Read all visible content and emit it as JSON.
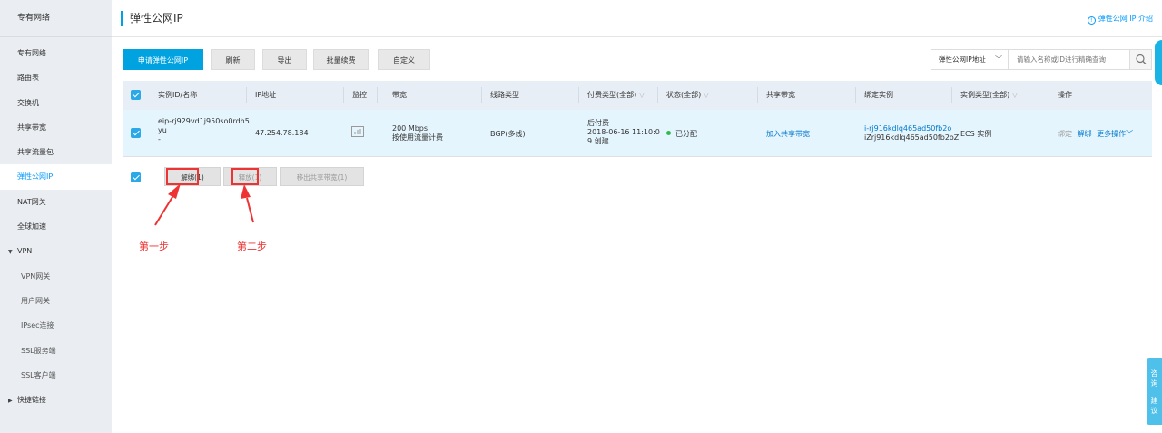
{
  "sidebar": {
    "title": "专有网络",
    "items": [
      {
        "label": "专有网络"
      },
      {
        "label": "路由表"
      },
      {
        "label": "交换机"
      },
      {
        "label": "共享带宽"
      },
      {
        "label": "共享流量包"
      },
      {
        "label": "弹性公网IP"
      },
      {
        "label": "NAT网关"
      },
      {
        "label": "全球加速"
      }
    ],
    "vpn_group": {
      "label": "VPN",
      "items": [
        {
          "label": "VPN网关"
        },
        {
          "label": "用户网关"
        },
        {
          "label": "IPsec连接"
        },
        {
          "label": "SSL服务端"
        },
        {
          "label": "SSL客户端"
        }
      ]
    },
    "shortcut": {
      "label": "快捷链接"
    },
    "active": "弹性公网IP"
  },
  "header": {
    "title": "弹性公网IP",
    "intro_link": "弹性公网 IP 介绍"
  },
  "toolbar": {
    "apply": "申请弹性公网IP",
    "refresh": "刷新",
    "export": "导出",
    "batch_renew": "批量续费",
    "customize": "自定义"
  },
  "search": {
    "select_value": "弹性公网IP地址",
    "placeholder": "请输入名称或ID进行精确查询"
  },
  "table": {
    "columns": [
      "实例ID/名称",
      "IP地址",
      "监控",
      "带宽",
      "线路类型",
      "付费类型(全部)",
      "状态(全部)",
      "共享带宽",
      "绑定实例",
      "实例类型(全部)",
      "操作"
    ],
    "rows": [
      {
        "id_line1": "eip-rj929vd1j950so0rdh5",
        "id_line2": "yu",
        "id_line3": "-",
        "ip": "47.254.78.184",
        "bandwidth_line1": "200 Mbps",
        "bandwidth_line2": "按使用流量计费",
        "line_type": "BGP(多线)",
        "pay_line1": "后付费",
        "pay_line2": "2018-06-16 11:10:0",
        "pay_line3": "9 创建",
        "status": "已分配",
        "shared_bw": "加入共享带宽",
        "bound_line1": "i-rj916kdlq465ad50fb2o",
        "bound_line2": "iZrj916kdlq465ad50fb2oZ",
        "instance_type": "ECS 实例",
        "op_bind": "绑定",
        "op_unbind": "解绑",
        "op_more": "更多操作"
      }
    ]
  },
  "bulk": {
    "unbind": "解绑(1)",
    "release": "释放(1)",
    "remove_shared": "移出共享带宽(1)"
  },
  "annotations": {
    "step1": "第一步",
    "step2": "第二步"
  },
  "help": {
    "consult": "咨询",
    "suggest": "建议"
  },
  "colors": {
    "accent": "#00a2e0",
    "annotation": "#ee3333",
    "active_nav": "#0099ff"
  }
}
